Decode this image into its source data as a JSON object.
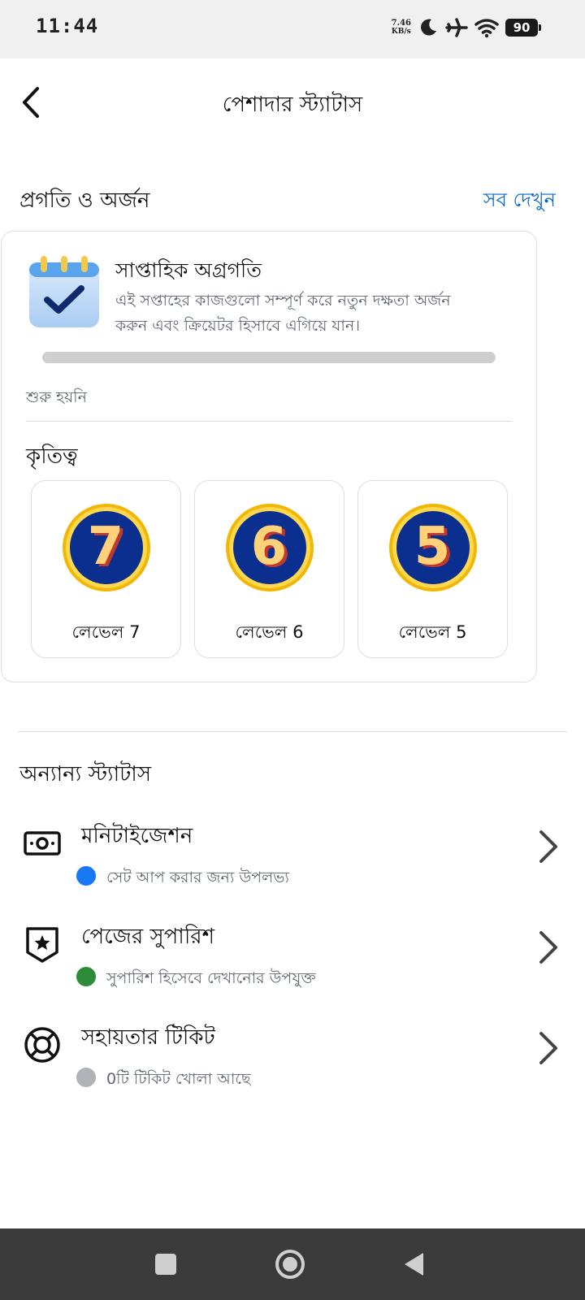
{
  "status_bar": {
    "time": "11:44",
    "net_speed_value": "7.46",
    "net_speed_unit": "KB/s",
    "battery": "90",
    "icons": [
      "moon-icon",
      "airplane-icon",
      "wifi-icon",
      "battery-icon"
    ]
  },
  "header": {
    "title": "পেশাদার স্ট্যাটাস",
    "back_icon": "chevron-left-icon"
  },
  "progress_section": {
    "title": "প্রগতি ও অর্জন",
    "see_all": "সব দেখুন"
  },
  "weekly": {
    "title": "সাপ্তাহিক অগ্রগতি",
    "description_line1": "এই সপ্তাহের কাজগুলো সম্পূর্ণ করে নতুন দক্ষতা অর্জন",
    "description_line2": "করুন এবং ক্রিয়েটর হিসাবে এগিয়ে যান।",
    "progress_fraction": 0,
    "status": "শুরু হয়নি",
    "icon": "calendar-check-icon"
  },
  "achievements": {
    "title": "কৃতিত্ব",
    "badges": [
      {
        "number": "7",
        "label": "লেভেল 7"
      },
      {
        "number": "6",
        "label": "লেভেল 6"
      },
      {
        "number": "5",
        "label": "লেভেল 5"
      }
    ]
  },
  "other_status": {
    "title": "অন্যান্য স্ট্যাটাস",
    "items": [
      {
        "title": "মনিটাইজেশন",
        "subtitle": "সেট আপ করার জন্য উপলভ্য",
        "dot_color": "#1877f2",
        "icon": "money-icon"
      },
      {
        "title": "পেজের সুপারিশ",
        "subtitle": "সুপারিশ হিসেবে দেখানোর উপযুক্ত",
        "dot_color": "#2e8b37",
        "icon": "shield-star-icon"
      },
      {
        "title": "সহায়তার টিকিট",
        "subtitle": "0টি টিকিট খোলা আছে",
        "dot_color": "#b0b3b8",
        "icon": "lifebuoy-icon"
      }
    ]
  },
  "colors": {
    "link": "#0a66c2",
    "medal_blue": "#0b2f8f",
    "medal_gold": "#f5c518"
  },
  "nav_bar": {
    "icons": [
      "square-icon",
      "circle-home-icon",
      "back-triangle-icon"
    ]
  }
}
